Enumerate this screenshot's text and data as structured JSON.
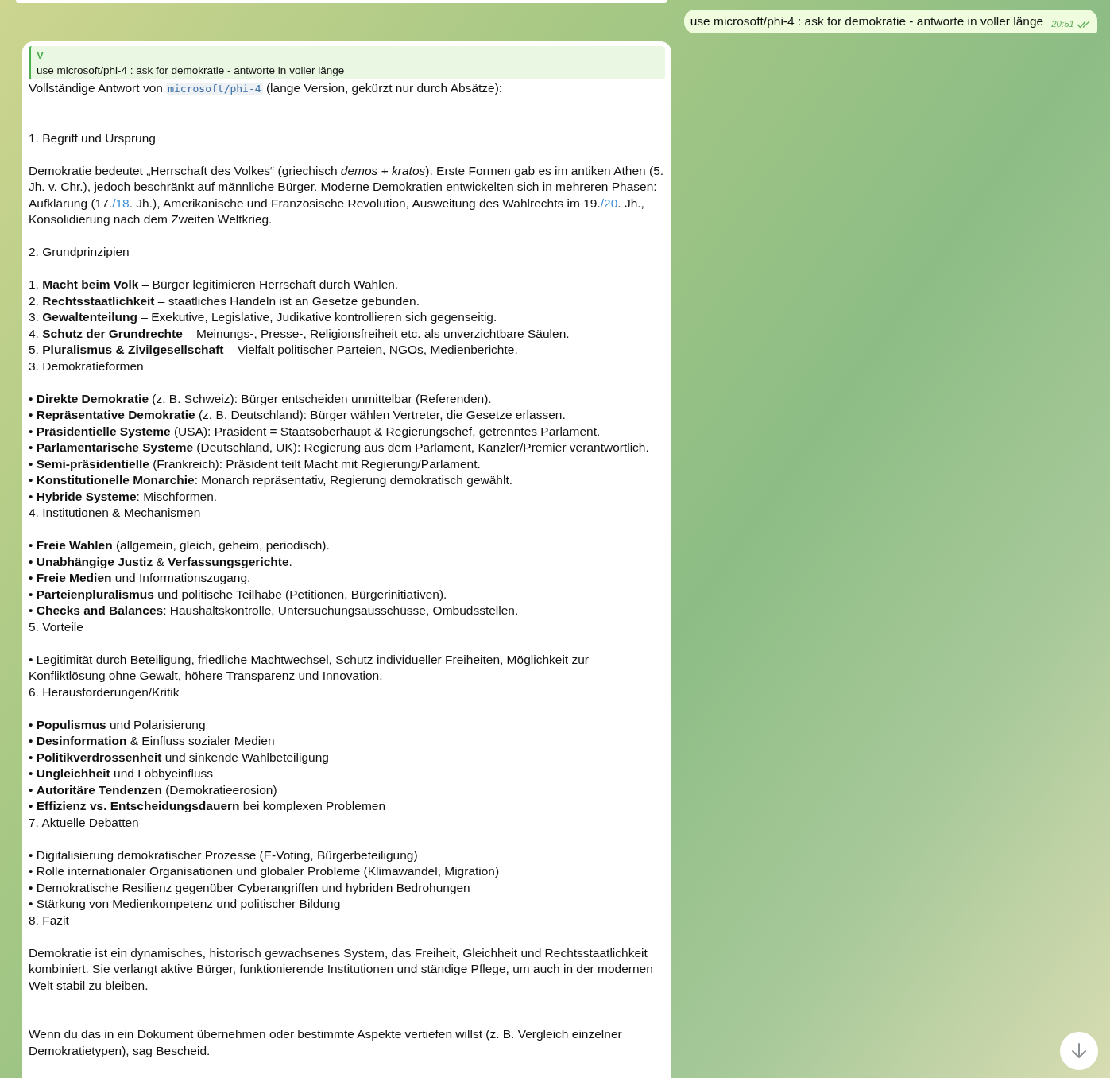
{
  "outgoing_message": {
    "text": "use microsoft/phi-4 : ask for demokratie - antworte in voller länge",
    "time": "20:51",
    "read": true
  },
  "incoming_message": {
    "reply_quote": {
      "sender": "V",
      "text": "use microsoft/phi-4 : ask for demokratie - antworte in voller länge"
    },
    "blocks": [
      {
        "kind": "wide",
        "lines": [
          {
            "segments": [
              {
                "kind": "text",
                "text": "Vollständige Antwort von "
              },
              {
                "kind": "code",
                "text": "microsoft/phi-4"
              },
              {
                "kind": "text",
                "text": " (lange Version, gekürzt nur durch Absätze):"
              }
            ]
          }
        ]
      },
      {
        "kind": "normal",
        "lines": [
          {
            "text": "1. Begriff und Ursprung"
          }
        ]
      },
      {
        "kind": "normal",
        "lines": [
          {
            "segments": [
              {
                "kind": "text",
                "text": "Demokratie bedeutet „Herrschaft des Volkes“ (griechisch *demos* + *kratos*). Erste Formen gab es im antiken Athen (5. Jh. v. Chr.), jedoch beschränkt auf männliche Bürger. Moderne Demokratien entwickelten sich in mehreren Phasen: Aufklärung (17."
              },
              {
                "kind": "link",
                "text": "/18"
              },
              {
                "kind": "text",
                "text": ". Jh.), Amerikanische und Französische Revolution, Ausweitung des Wahlrechts im 19."
              },
              {
                "kind": "link",
                "text": "/20"
              },
              {
                "kind": "text",
                "text": ". Jh., Konsolidierung nach dem Zweiten Weltkrieg."
              }
            ]
          }
        ]
      },
      {
        "kind": "normal",
        "lines": [
          {
            "text": "2. Grundprinzipien"
          }
        ]
      },
      {
        "kind": "normal",
        "lines": [
          {
            "text": "1. **Macht beim Volk** – Bürger legitimieren Herrschaft durch Wahlen."
          },
          {
            "text": "2. **Rechtsstaatlichkeit** – staatliches Handeln ist an Gesetze gebunden."
          },
          {
            "text": "3. **Gewaltenteilung** – Exekutive, Legislative, Judikative kontrollieren sich gegenseitig."
          },
          {
            "text": "4. **Schutz der Grundrechte** – Meinungs-, Presse-, Religionsfreiheit etc. als unverzichtbare Säulen."
          },
          {
            "text": "5. **Pluralismus & Zivilgesellschaft** – Vielfalt politischer Parteien, NGOs, Medienberichte."
          },
          {
            "text": "3. Demokratieformen"
          }
        ]
      },
      {
        "kind": "normal",
        "lines": [
          {
            "text": "• **Direkte Demokratie** (z. B. Schweiz): Bürger entscheiden unmittelbar (Referenden)."
          },
          {
            "text": "• **Repräsentative Demokratie** (z. B. Deutschland): Bürger wählen Vertreter, die Gesetze erlassen."
          },
          {
            "text": "• **Präsidentielle Systeme** (USA): Präsident = Staatsoberhaupt & Regierungschef, getrenntes Parlament."
          },
          {
            "text": "• **Parlamentarische Systeme** (Deutschland, UK): Regierung aus dem Parlament, Kanzler/Premier verantwortlich."
          },
          {
            "text": "• **Semi-präsidentielle** (Frankreich): Präsident teilt Macht mit Regierung/Parlament."
          },
          {
            "text": "• **Konstitutionelle Monarchie**: Monarch repräsentativ, Regierung demokratisch gewählt."
          },
          {
            "text": "• **Hybride Systeme**: Mischformen."
          },
          {
            "text": "4. Institutionen & Mechanismen"
          }
        ]
      },
      {
        "kind": "normal",
        "lines": [
          {
            "text": "• **Freie Wahlen** (allgemein, gleich, geheim, periodisch)."
          },
          {
            "text": "• **Unabhängige Justiz** & **Verfassungsgerichte**."
          },
          {
            "text": "• **Freie Medien** und Informationszugang."
          },
          {
            "text": "• **Parteienpluralismus** und politische Teilhabe (Petitionen, Bürgerinitiativen)."
          },
          {
            "text": "• **Checks and Balances**: Haushaltskontrolle, Untersuchungsausschüsse, Ombudsstellen."
          },
          {
            "text": "5. Vorteile"
          }
        ]
      },
      {
        "kind": "normal",
        "lines": [
          {
            "text": "• Legitimität durch Beteiligung, friedliche Machtwechsel, Schutz individueller Freiheiten, Möglichkeit zur Konfliktlösung ohne Gewalt, höhere Transparenz und Innovation."
          },
          {
            "text": "6. Herausforderungen/Kritik"
          }
        ]
      },
      {
        "kind": "normal",
        "lines": [
          {
            "text": "• **Populismus** und Polarisierung"
          },
          {
            "text": "• **Desinformation** & Einfluss sozialer Medien"
          },
          {
            "text": "• **Politikverdrossenheit** und sinkende Wahlbeteiligung"
          },
          {
            "text": "• **Ungleichheit** und Lobbyeinfluss"
          },
          {
            "text": "• **Autoritäre Tendenzen** (Demokratieerosion)"
          },
          {
            "text": "• **Effizienz vs. Entscheidungsdauern** bei komplexen Problemen"
          },
          {
            "text": "7. Aktuelle Debatten"
          }
        ]
      },
      {
        "kind": "normal",
        "lines": [
          {
            "text": "• Digitalisierung demokratischer Prozesse (E-Voting, Bürgerbeteiligung)"
          },
          {
            "text": "• Rolle internationaler Organisationen und globaler Probleme (Klimawandel, Migration)"
          },
          {
            "text": "• Demokratische Resilienz gegenüber Cyberangriffen und hybriden Bedrohungen"
          },
          {
            "text": "• Stärkung von Medienkompetenz und politischer Bildung"
          },
          {
            "text": "8. Fazit"
          }
        ]
      },
      {
        "kind": "wide",
        "lines": [
          {
            "text": "Demokratie ist ein dynamisches, historisch gewachsenes System, das Freiheit, Gleichheit und Rechtsstaatlichkeit kombiniert. Sie verlangt aktive Bürger, funktionierende Institutionen und ständige Pflege, um auch in der modernen Welt stabil zu bleiben."
          }
        ]
      },
      {
        "kind": "normal",
        "lines": [
          {
            "text": "Wenn du das in ein Dokument übernehmen oder bestimmte Aspekte vertiefen willst (z. B. Vergleich einzelner Demokratietypen), sag Bescheid."
          }
        ]
      }
    ]
  }
}
